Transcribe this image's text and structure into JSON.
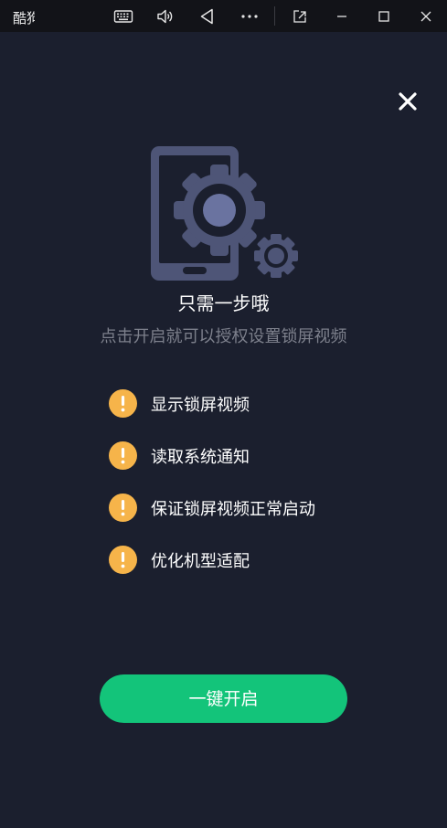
{
  "window": {
    "app_title": "酷狗",
    "icons": [
      "keyboard-icon",
      "volume-icon",
      "back-icon",
      "more-icon",
      "popout-icon",
      "minimize-icon",
      "maximize-icon",
      "close-icon"
    ]
  },
  "dialog": {
    "close_icon": "close-x-icon",
    "illustration_icon": "phone-gears-icon",
    "headline": "只需一步哦",
    "subline": "点击开启就可以授权设置锁屏视频",
    "permissions": [
      {
        "icon": "warning-icon",
        "label": "显示锁屏视频"
      },
      {
        "icon": "warning-icon",
        "label": "读取系统通知"
      },
      {
        "icon": "warning-icon",
        "label": "保证锁屏视频正常启动"
      },
      {
        "icon": "warning-icon",
        "label": "优化机型适配"
      }
    ],
    "cta_label": "一键开启"
  },
  "colors": {
    "background": "#1b1f2e",
    "titlebar": "#121318",
    "accent_green": "#13c47a",
    "warning_orange": "#f6b44a",
    "illustration": "#4e5577"
  }
}
